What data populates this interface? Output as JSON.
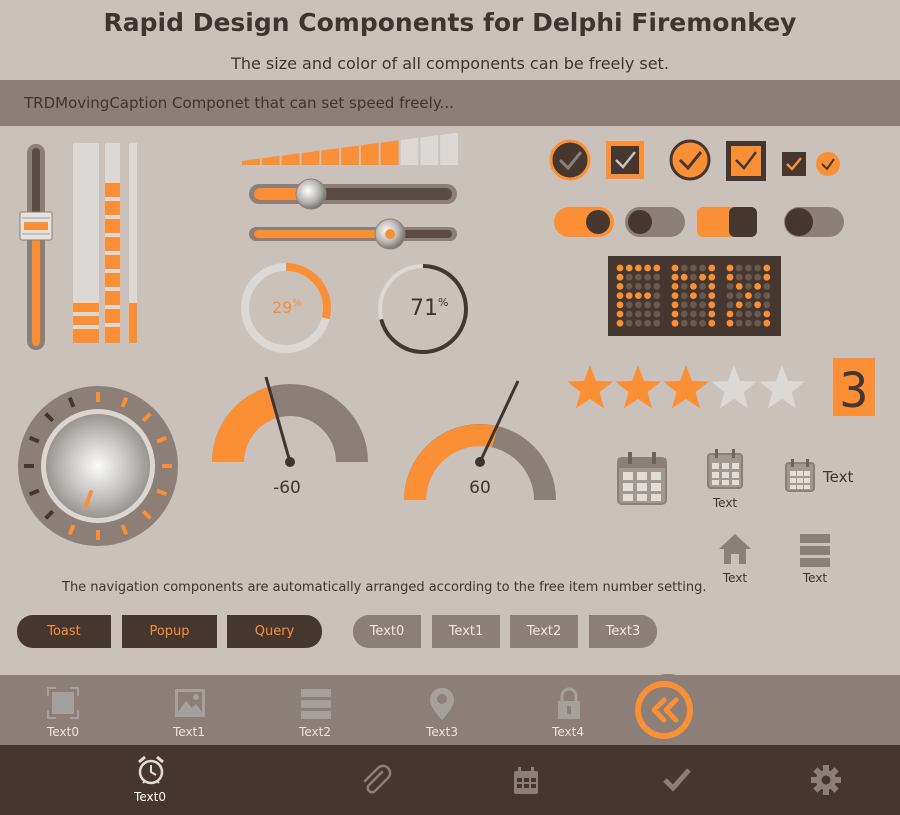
{
  "header": {
    "title": "Rapid Design Components for Delphi Firemonkey",
    "subtitle": "The size and color of all components can be freely set."
  },
  "moving_caption": {
    "text": "TRDMovingCaption Componet that can set speed freely..."
  },
  "progress": {
    "ring1_percent": 29,
    "ring1_value": "29",
    "ring1_unit": "%",
    "ring2_percent": 71,
    "ring2_value": "71",
    "ring2_unit": "%"
  },
  "gauges": {
    "left_value": "-60",
    "right_value": "60"
  },
  "matrix_display": {
    "text": "FMX"
  },
  "rating": {
    "stars": 3,
    "max": 5,
    "digit": "3"
  },
  "calendar_icons": {
    "label1": "Text",
    "label2": "Text",
    "home_label": "Text",
    "menu_label": "Text"
  },
  "nav_note": "The navigation components are automatically arranged according to the free item number setting.",
  "buttons": {
    "toast": "Toast",
    "popup": "Popup",
    "query": "Query"
  },
  "pill_tabs": [
    "Text0",
    "Text1",
    "Text2",
    "Text3"
  ],
  "toolbar": {
    "items": [
      "Text0",
      "Text1",
      "Text2",
      "Text3",
      "Text4"
    ]
  },
  "bottombar": {
    "active_label": "Text0"
  },
  "colors": {
    "accent": "#fb8f35",
    "dark": "#45372f",
    "mid": "#8c7f77",
    "bg": "#cbc1bb"
  }
}
